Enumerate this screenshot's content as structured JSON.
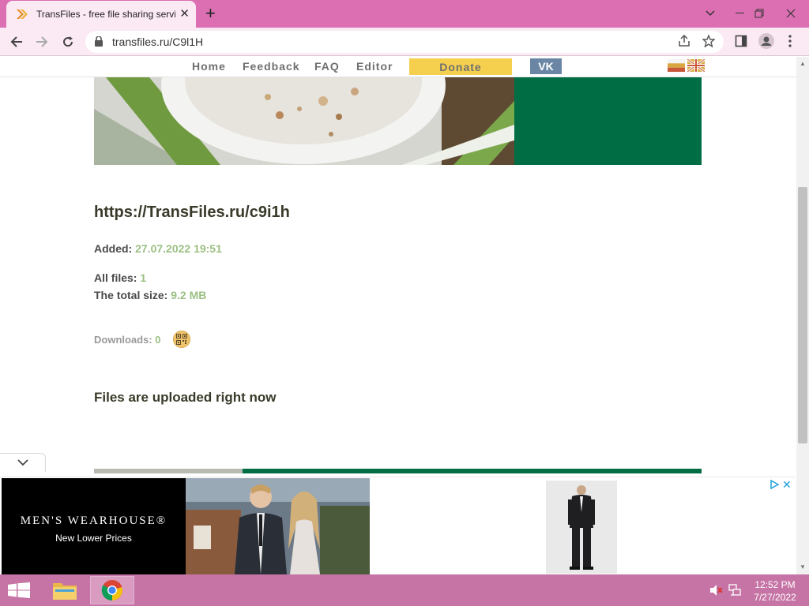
{
  "browser": {
    "tab_title": "TransFiles - free file sharing servi",
    "url": "transfiles.ru/C9l1H"
  },
  "nav": {
    "home": "Home",
    "feedback": "Feedback",
    "faq": "FAQ",
    "editor": "Editor",
    "donate": "Donate",
    "vk": "VK"
  },
  "content": {
    "share_url": "https://TransFiles.ru/c9i1h",
    "added_label": "Added:",
    "added_value": "27.07.2022 19:51",
    "all_files_label": "All files:",
    "all_files_value": "1",
    "total_size_label": "The total size:",
    "total_size_value": "9.2 MB",
    "downloads_label": "Downloads:",
    "downloads_value": "0",
    "status": "Files are uploaded right now"
  },
  "ad": {
    "brand": "MEN'S WEARHOUSE®",
    "tagline": "New Lower Prices"
  },
  "taskbar": {
    "time": "12:52 PM",
    "date": "7/27/2022"
  },
  "colors": {
    "titlebar": "#db6fb1",
    "banner_green": "#006d45",
    "donate_yellow": "#f5d04f",
    "vk_blue": "#6b86a5",
    "value_green": "#9bbf83"
  }
}
